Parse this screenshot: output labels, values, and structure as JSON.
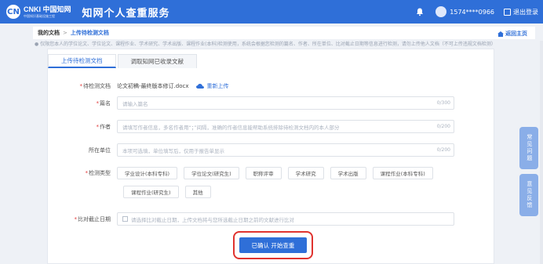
{
  "header": {
    "logo_mark": "CN",
    "logo_brand": "CNKI 中国知网",
    "logo_sub": "中国知识基础设施工程",
    "title": "知网个人查重服务",
    "user_name": "1574****0966",
    "logout": "退出登录"
  },
  "breadcrumb": {
    "home": "我的文档",
    "separator": ">",
    "current": "上传待检测文档",
    "back_home": "返回主页"
  },
  "notice": "● 仅限您本人的学位论文、学位论文、课程作业、学术研究、学术出版、课程作业(本科)检测使用，系统会根据您检测的篇名、作者、所在单位、比对截止日期等信息进行检测，请勿上传他人文档（不可上传违规文档检测）",
  "tabs": [
    {
      "label": "上传待检测文档",
      "active": true
    },
    {
      "label": "调取知网已收录文献",
      "active": false
    }
  ],
  "form": {
    "file": {
      "label": "待检测文档",
      "filename": "论文初稿-最终版本修订.docx",
      "reupload": "重新上传"
    },
    "title": {
      "label": "篇名",
      "placeholder": "请输入篇名",
      "counter": "0/300"
    },
    "author": {
      "label": "作者",
      "placeholder": "请填写作者信息，多名作者用“；”间隔，准确的作者信息能帮助系统排除待检测文档内的本人部分",
      "counter": "0/200"
    },
    "unit": {
      "label": "所在单位",
      "placeholder": "本项可选填，单位填写后，仅用于报告单显示",
      "counter": "0/200"
    },
    "type": {
      "label": "检测类型",
      "options": [
        "学业设计(本科专科)",
        "学位论文(研究生)",
        "职称评审",
        "学术研究",
        "学术出版",
        "课程作业(本科专科)",
        "课程作业(研究生)",
        "其他"
      ]
    },
    "date": {
      "label": "比对截止日期",
      "placeholder": "请选择比对截止日期，上传文档将与您所选截止日期之前的文献进行比对"
    }
  },
  "submit_label": "已确认 开始查重",
  "side_buttons": [
    {
      "label": "常见问题"
    },
    {
      "label": "意见反馈"
    }
  ],
  "colors": {
    "primary": "#2f6fd8",
    "highlight": "#e0332f",
    "required": "#e23b3b"
  }
}
